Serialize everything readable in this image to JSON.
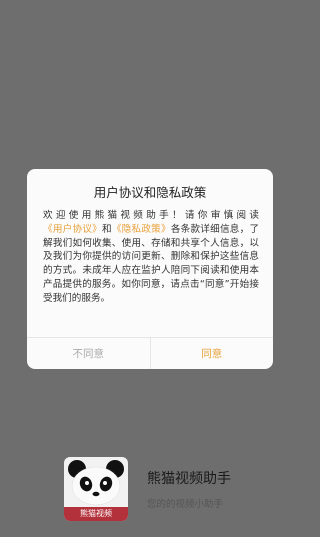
{
  "dialog": {
    "title": "用户协议和隐私政策",
    "intro": "欢迎使用熊猫视频助手！请你审慎阅读",
    "link_user_agreement": "《用户协议》",
    "and_word": "和",
    "link_privacy_policy": "《隐私政策》",
    "body_rest": "各条款详细信息，了解我们如何收集、使用、存储和共享个人信息，以及我们为你提供的访问更新、删除和保护这些信息的方式。未成年人应在监护人陪同下阅读和使用本产品提供的服务。如你同意，请点击“同意”开始接受我们的服务。",
    "decline_label": "不同意",
    "accept_label": "同意"
  },
  "app": {
    "name": "熊猫视频助手",
    "slogan": "您的的视频小助手",
    "icon_caption": "熊猫视频"
  },
  "colors": {
    "accent": "#e8a13a",
    "overlay": "#6e6e6e",
    "icon_banner": "#b3313b"
  }
}
